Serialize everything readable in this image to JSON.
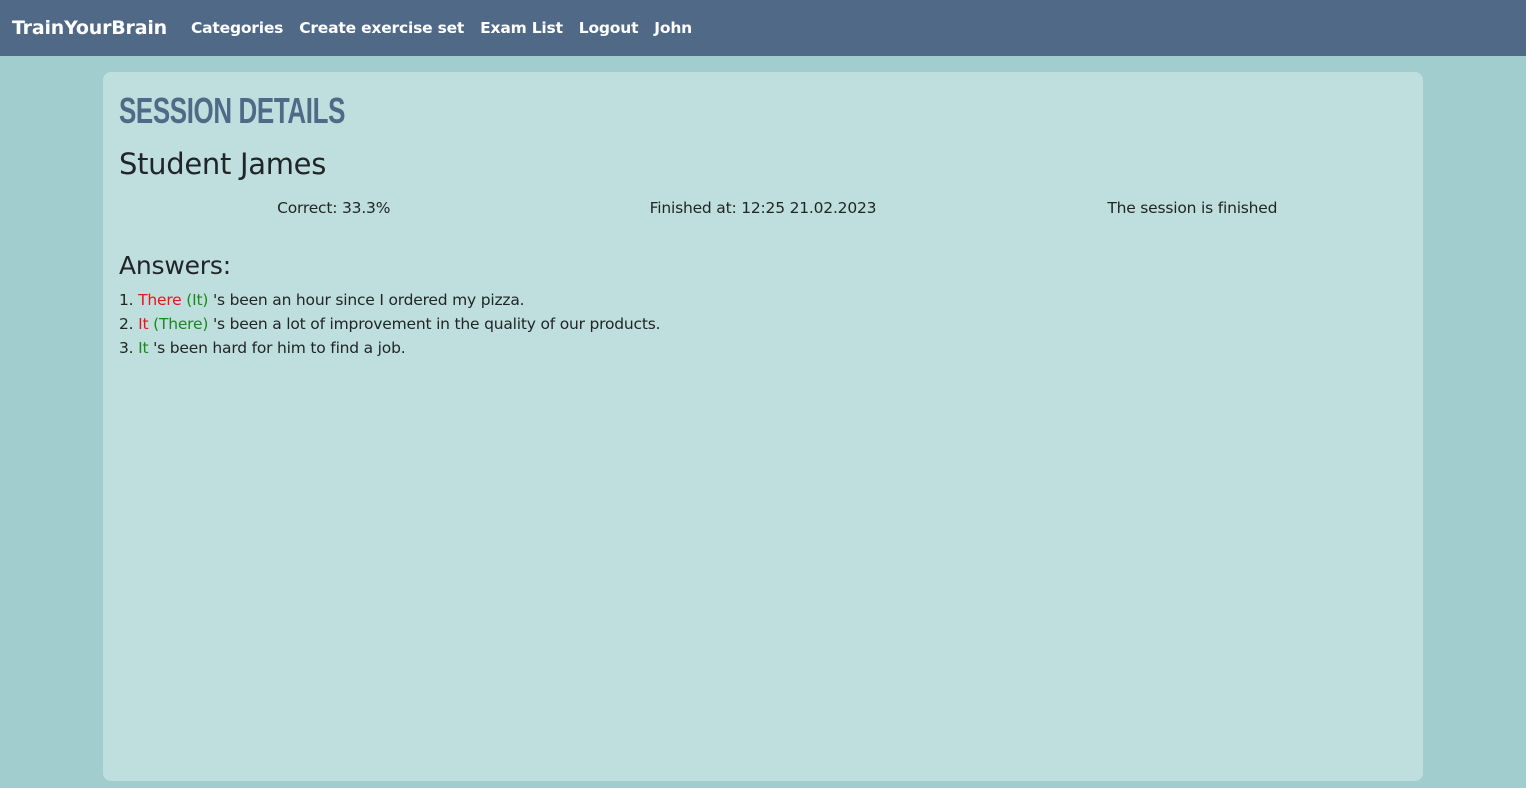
{
  "navbar": {
    "brand": "TrainYourBrain",
    "links": [
      "Categories",
      "Create exercise set",
      "Exam List",
      "Logout",
      "John"
    ]
  },
  "session": {
    "title": "Session details",
    "student": "Student James",
    "correct": "Correct: 33.3%",
    "finished_at": "Finished at: 12:25 21.02.2023",
    "status": "The session is finished"
  },
  "answers": {
    "heading": "Answers:",
    "items": [
      {
        "number": "1.",
        "given": "There",
        "correct": "(It)",
        "rest": "'s been an hour since I ordered my pizza."
      },
      {
        "number": "2.",
        "given": "It",
        "correct": "(There)",
        "rest": "'s been a lot of improvement in the quality of our products."
      },
      {
        "number": "3.",
        "given": "It",
        "rest": "'s been hard for him to find a job."
      }
    ]
  },
  "colors": {
    "navbar_bg": "#506987",
    "page_bg": "#a1cdcf",
    "card_bg": "#bfdfde",
    "title": "#506987",
    "wrong_answer": "#e8141c",
    "correct_answer": "#198a1b"
  }
}
